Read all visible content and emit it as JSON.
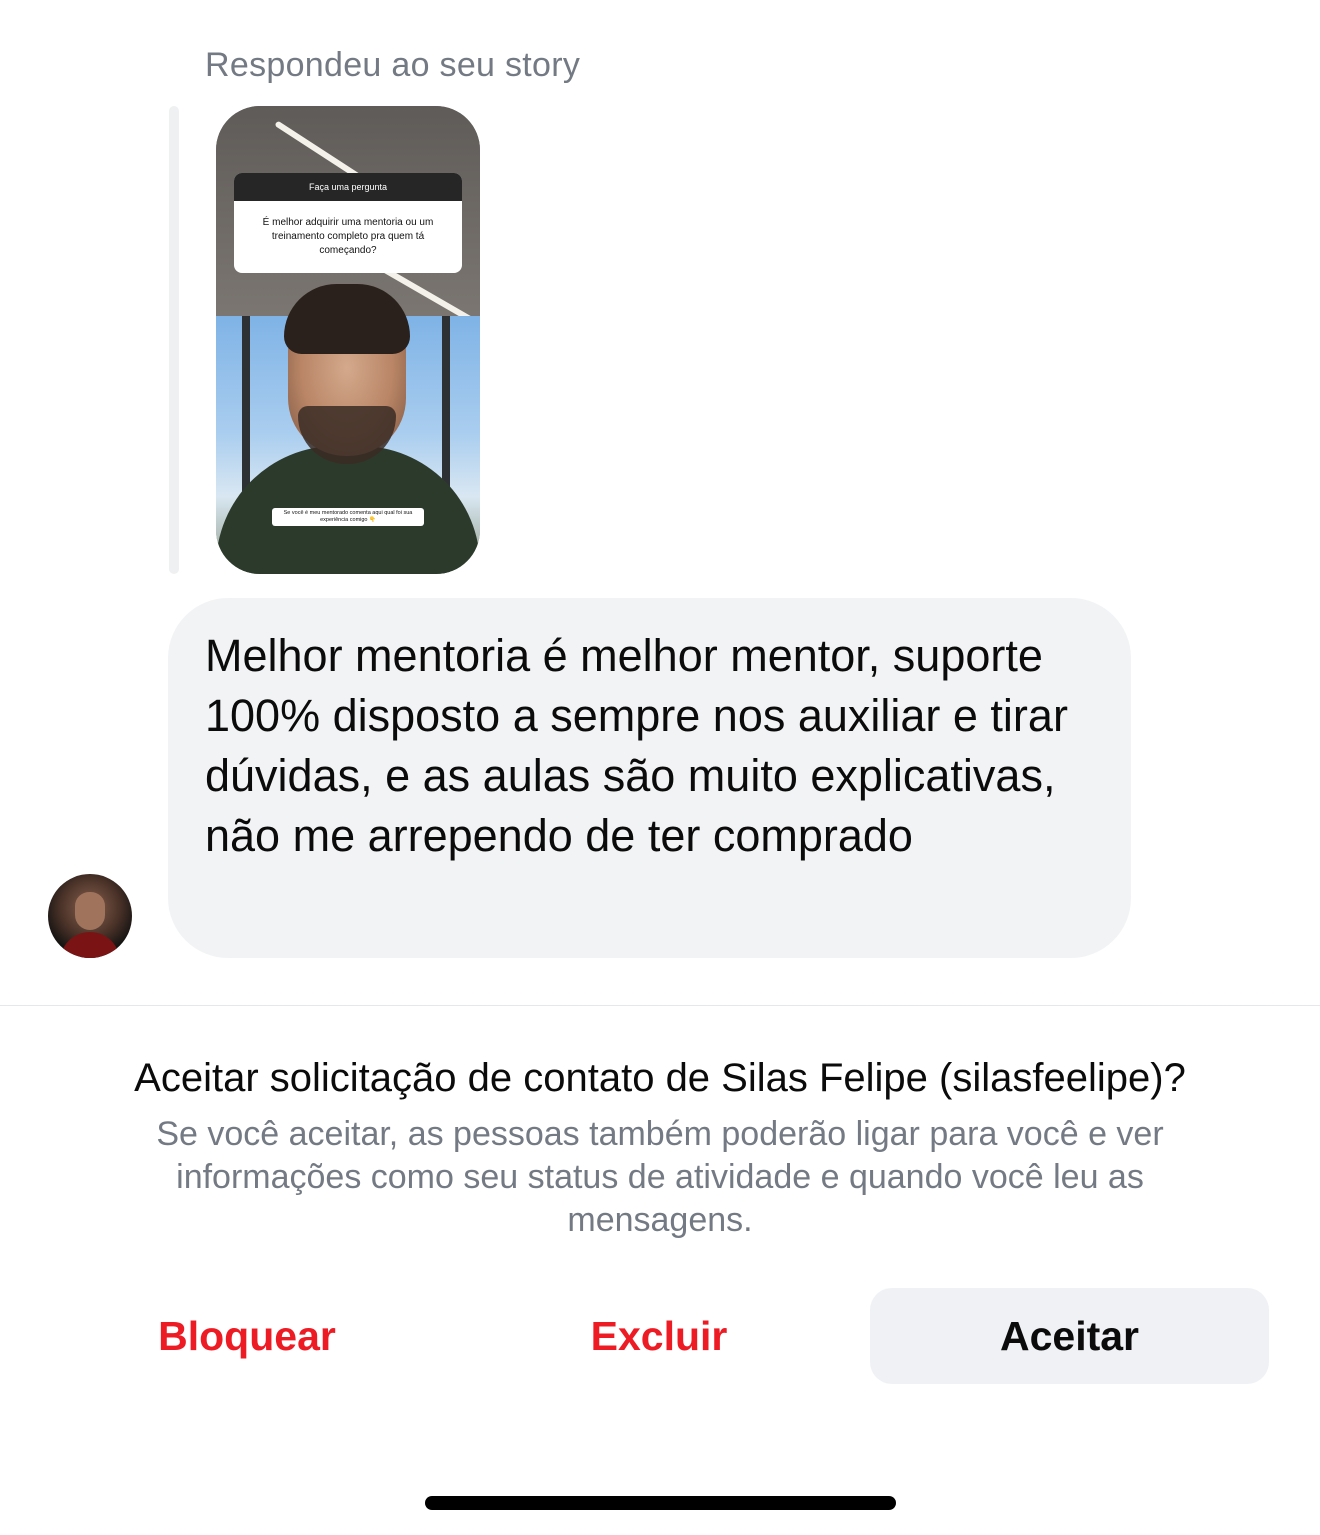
{
  "story_reply": {
    "caption": "Respondeu ao seu story",
    "story": {
      "question_header": "Faça uma pergunta",
      "question_text": "É melhor adquirir uma mentoria ou um treinamento completo pra quem tá começando?",
      "bottom_caption": "Se você é meu mentorado comenta aqui qual foi sua experiência comigo 👇"
    }
  },
  "message": {
    "text": "Melhor mentoria é melhor mentor, suporte 100% disposto a sempre nos auxiliar e tirar dúvidas, e as aulas são muito explicativas, não me arrependo de ter comprado"
  },
  "request": {
    "title": "Aceitar solicitação de contato de Silas Felipe (silasfeelipe)?",
    "description": "Se você aceitar, as pessoas também poderão ligar para você e ver informações como seu status de atividade e quando você leu as mensagens."
  },
  "actions": {
    "block_label": "Bloquear",
    "delete_label": "Excluir",
    "accept_label": "Aceitar"
  },
  "colors": {
    "destructive": "#ed1c24",
    "bubble": "#f2f3f5",
    "secondary_text": "#737a83",
    "accept_button_bg": "#eff1f4"
  }
}
